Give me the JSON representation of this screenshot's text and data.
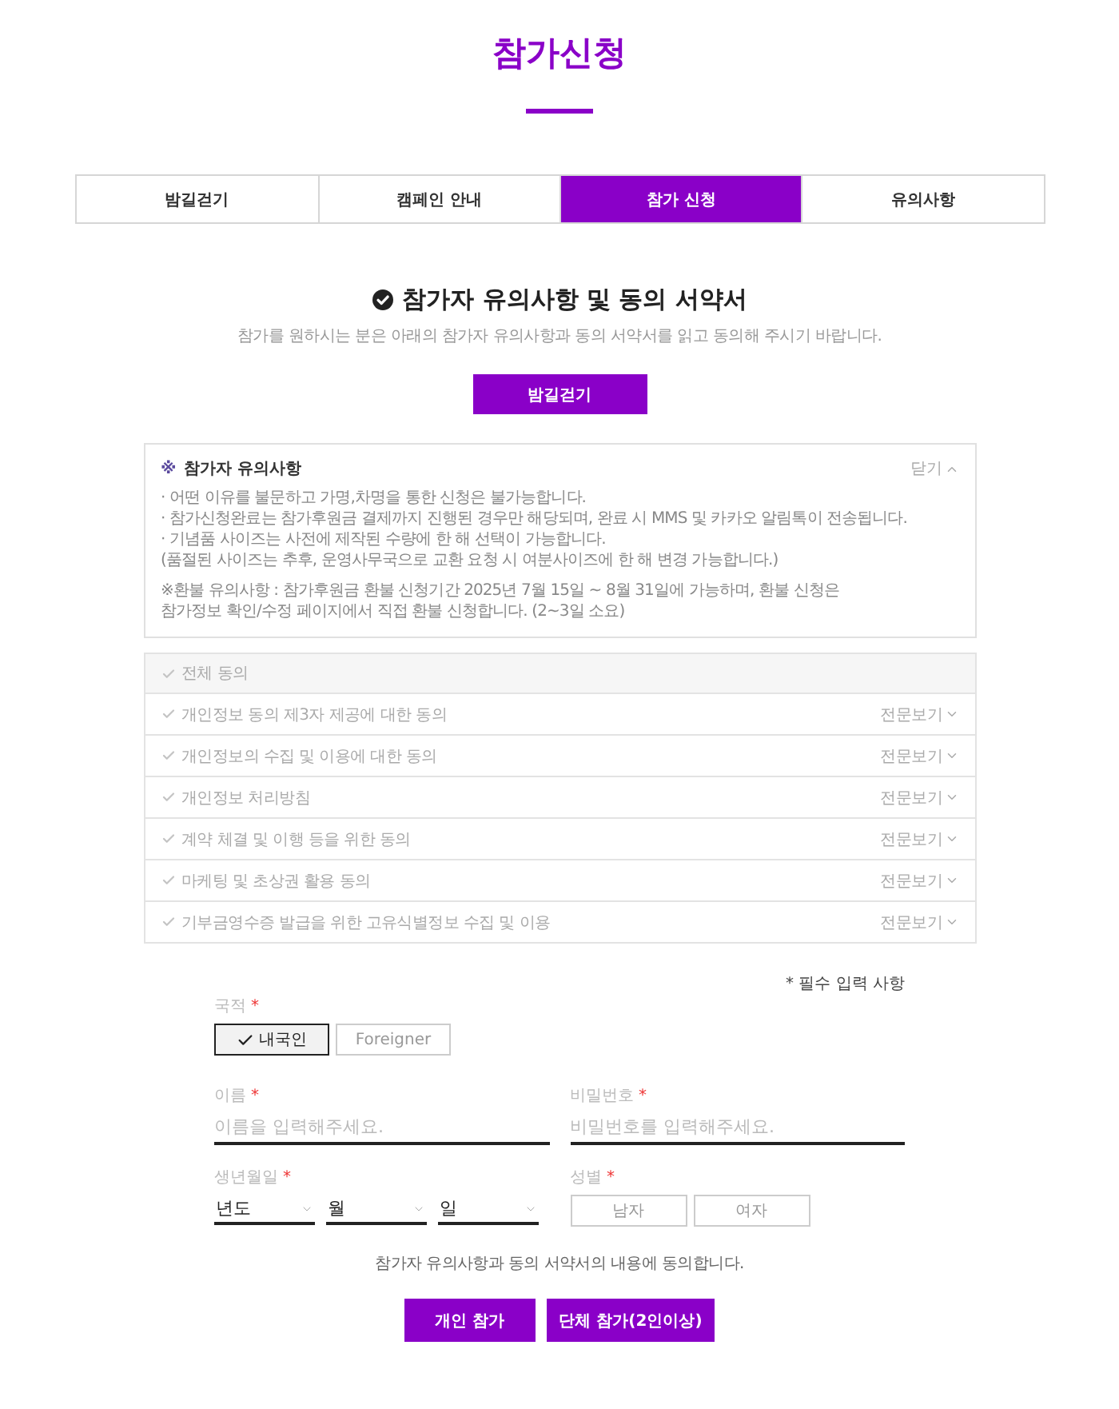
{
  "page_title": "참가신청",
  "tabs": [
    {
      "label": "밤길걷기",
      "selected": false
    },
    {
      "label": "캠페인 안내",
      "selected": false
    },
    {
      "label": "참가 신청",
      "selected": true
    },
    {
      "label": "유의사항",
      "selected": false
    }
  ],
  "section": {
    "heading": "참가자 유의사항 및 동의 서약서",
    "description": "참가를 원하시는 분은 아래의 참가자 유의사항과 동의 서약서를 읽고 동의해 주시기 바랍니다.",
    "button": "밤길걷기"
  },
  "notice": {
    "mark": "※",
    "title": "참가자 유의사항",
    "toggle": "닫기",
    "expanded": true,
    "lines": [
      "· 어떤 이유를 불문하고 가명,차명을 통한 신청은 불가능합니다.",
      "· 참가신청완료는 참가후원금 결제까지 진행된 경우만 해당되며, 완료 시 MMS 및 카카오 알림톡이 전송됩니다.",
      "· 기념품 사이즈는 사전에 제작된 수량에 한 해 선택이 가능합니다.",
      "(품절된 사이즈는 추후, 운영사무국으로 교환 요청 시 여분사이즈에 한 해 변경 가능합니다.)"
    ],
    "refund_lines": [
      "※환불 유의사항 : 참가후원금 환불 신청기간 2025년 7월 15일 ~ 8월 31일에 가능하며, 환불 신청은",
      "참가정보 확인/수정 페이지에서 직접 환불 신청합니다. (2~3일 소요)"
    ]
  },
  "agreements": [
    {
      "kind": "all",
      "label": "전체 동의",
      "checked": false
    },
    {
      "kind": "item",
      "label": "개인정보 동의 제3자 제공에 대한 동의",
      "checked": false,
      "link": "전문보기",
      "expanded": false
    },
    {
      "kind": "item",
      "label": "개인정보의 수집 및 이용에 대한 동의",
      "checked": false,
      "link": "전문보기",
      "expanded": false
    },
    {
      "kind": "item",
      "label": "개인정보 처리방침",
      "checked": false,
      "link": "전문보기",
      "expanded": false
    },
    {
      "kind": "item",
      "label": "계약 체결 및 이행 등을 위한 동의",
      "checked": false,
      "link": "전문보기",
      "expanded": false
    },
    {
      "kind": "item",
      "label": "마케팅 및 초상권 활용 동의",
      "checked": false,
      "link": "전문보기",
      "expanded": false
    },
    {
      "kind": "item",
      "label": "기부금영수증 발급을 위한 고유식별정보 수집 및 이용",
      "checked": false,
      "link": "전문보기",
      "expanded": false
    }
  ],
  "form": {
    "required_note": "* 필수 입력 사항",
    "nationality": {
      "label": "국적",
      "mark": "*",
      "options": [
        {
          "label": "내국인",
          "selected": true
        },
        {
          "label": "Foreigner",
          "selected": false
        }
      ]
    },
    "name": {
      "label": "이름",
      "mark": "*",
      "placeholder": "이름을 입력해주세요."
    },
    "password": {
      "label": "비밀번호",
      "mark": "*",
      "placeholder": "비밀번호를 입력해주세요."
    },
    "birth": {
      "label": "생년월일",
      "mark": "*",
      "selects": [
        {
          "value": "년도"
        },
        {
          "value": "월"
        },
        {
          "value": "일"
        }
      ]
    },
    "gender": {
      "label": "성별",
      "mark": "*",
      "options": [
        {
          "label": "남자",
          "selected": false
        },
        {
          "label": "여자",
          "selected": false
        }
      ]
    }
  },
  "consent": "참가자 유의사항과 동의 서약서의 내용에 동의합니다.",
  "actions": [
    "개인 참가",
    "단체 참가(2인이상)"
  ]
}
